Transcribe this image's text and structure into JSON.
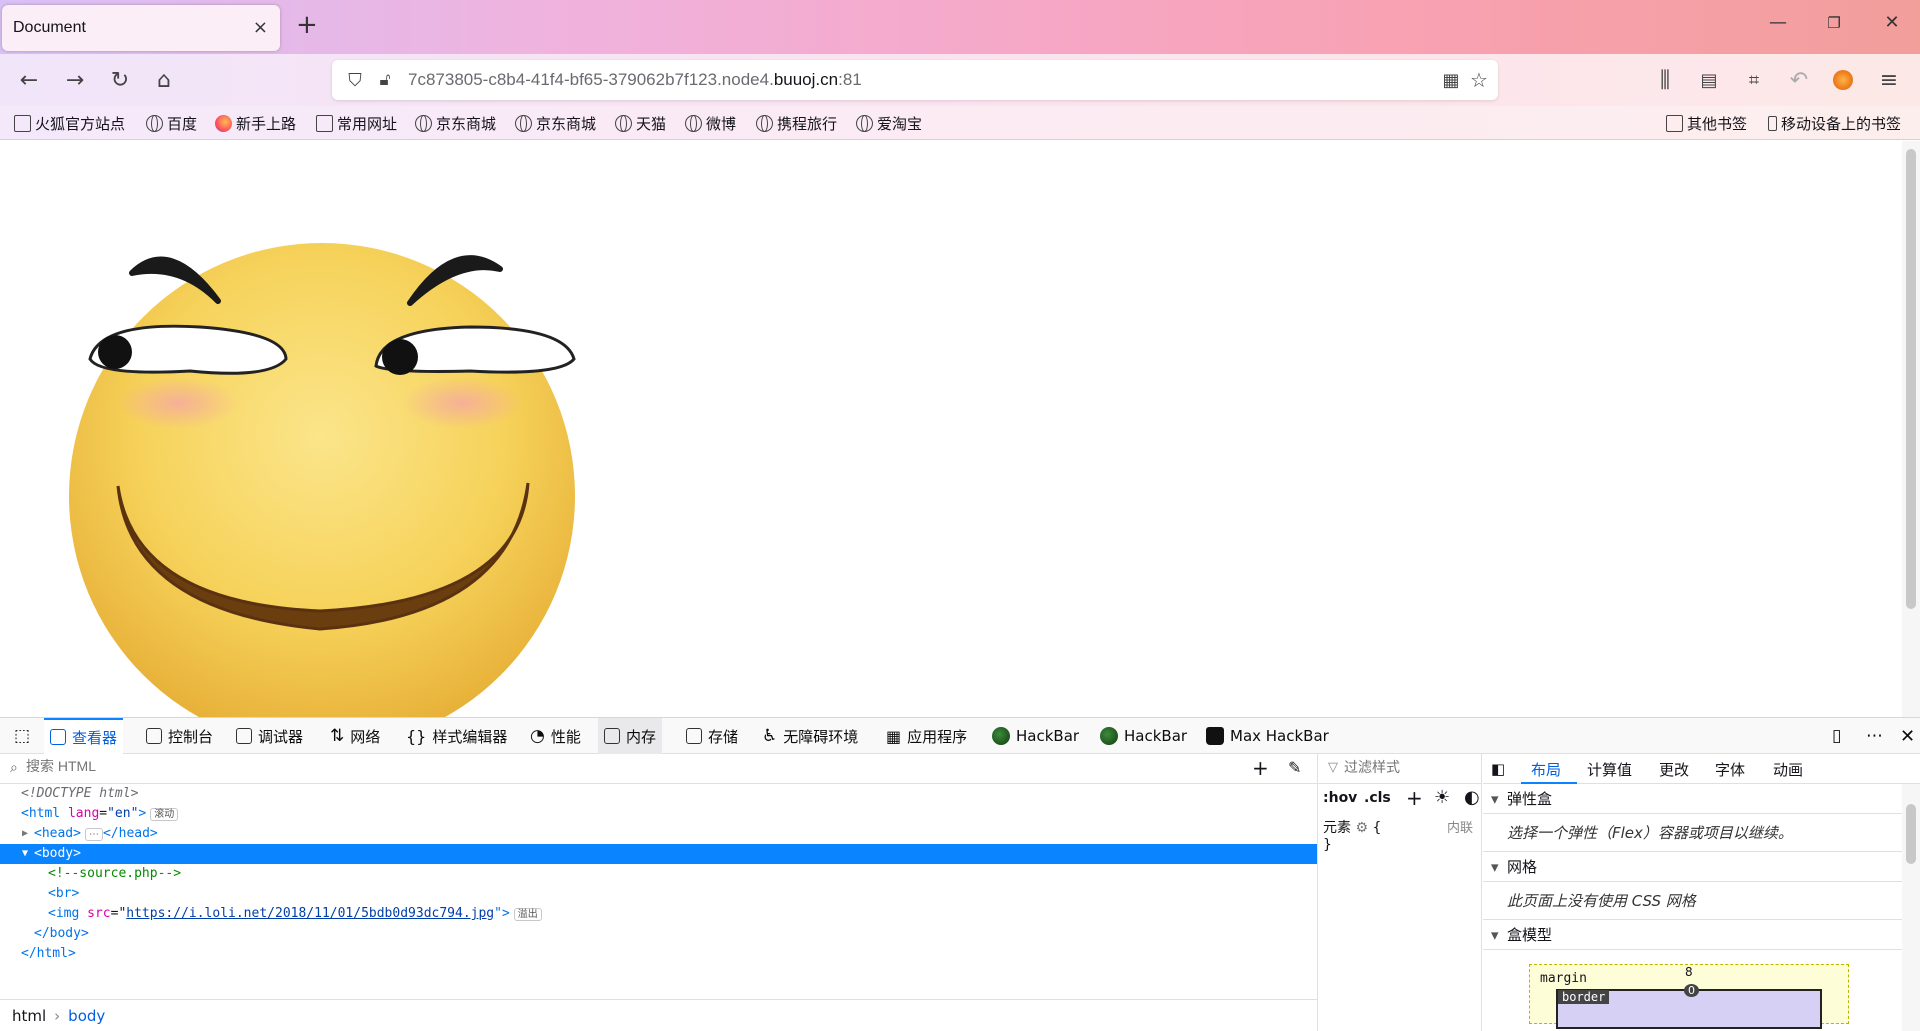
{
  "browser": {
    "tab_title": "Document",
    "tab_close": "×",
    "new_tab": "+",
    "url_prefix": "7c873805-c8b4-41f4-bf65-379062b7f123.node4.",
    "url_host": "buuoj.cn",
    "url_port": ":81"
  },
  "bookmarks": {
    "left": [
      {
        "label": "火狐官方站点",
        "icon": "folder-icon"
      },
      {
        "label": "百度",
        "icon": "globe-icon"
      },
      {
        "label": "新手上路",
        "icon": "firefox-icon"
      },
      {
        "label": "常用网址",
        "icon": "folder-icon"
      },
      {
        "label": "京东商城",
        "icon": "globe-icon"
      },
      {
        "label": "京东商城",
        "icon": "globe-icon"
      },
      {
        "label": "天猫",
        "icon": "globe-icon"
      },
      {
        "label": "微博",
        "icon": "globe-icon"
      },
      {
        "label": "携程旅行",
        "icon": "globe-icon"
      },
      {
        "label": "爱淘宝",
        "icon": "globe-icon"
      }
    ],
    "other": "其他书签",
    "mobile": "移动设备上的书签"
  },
  "devtools": {
    "tabs": [
      {
        "label": "查看器",
        "icon": "inspector-icon"
      },
      {
        "label": "控制台",
        "icon": "console-icon"
      },
      {
        "label": "调试器",
        "icon": "debugger-icon"
      },
      {
        "label": "网络",
        "icon": "network-icon"
      },
      {
        "label": "样式编辑器",
        "icon": "style-editor-icon"
      },
      {
        "label": "性能",
        "icon": "performance-icon"
      },
      {
        "label": "内存",
        "icon": "memory-icon"
      },
      {
        "label": "存储",
        "icon": "storage-icon"
      },
      {
        "label": "无障碍环境",
        "icon": "accessibility-icon"
      },
      {
        "label": "应用程序",
        "icon": "application-icon"
      },
      {
        "label": "HackBar",
        "icon": "hackbar-icon"
      },
      {
        "label": "HackBar",
        "icon": "hackbar-icon"
      },
      {
        "label": "Max HackBar",
        "icon": "lock-icon"
      }
    ],
    "search_placeholder": "搜索 HTML",
    "tree": {
      "doctype": "<!DOCTYPE html>",
      "html_open_tag": "<html",
      "html_attr": "lang",
      "html_attr_val": "\"en\"",
      "html_close_bracket": ">",
      "scroll_badge": "滚动",
      "head": "<head>",
      "head_badge": "⋯",
      "head_close": "</head>",
      "body": "<body>",
      "comment": "<!--source.php-->",
      "br": "<br>",
      "img_open": "<img",
      "img_attr": "src",
      "img_src": "https://i.loli.net/2018/11/01/5bdb0d93dc794.jpg",
      "img_close": "\">",
      "overflow_badge": "溢出",
      "body_close": "</body>",
      "html_close": "</html>"
    },
    "breadcrumbs": [
      "html",
      "body"
    ],
    "rules": {
      "filter_placeholder": "过滤样式",
      "hov": ":hov",
      "cls": ".cls",
      "element_label": "元素",
      "inline_label": "内联",
      "open_brace": "{",
      "close_brace": "}"
    },
    "layout": {
      "tabs": [
        "布局",
        "计算值",
        "更改",
        "字体",
        "动画"
      ],
      "flex_title": "弹性盒",
      "flex_note": "选择一个弹性（Flex）容器或项目以继续。",
      "grid_title": "网格",
      "grid_note": "此页面上没有使用 CSS 网格",
      "box_title": "盒模型",
      "margin_label": "margin",
      "margin_top": "8",
      "border_label": "border",
      "border_top": "0"
    }
  }
}
